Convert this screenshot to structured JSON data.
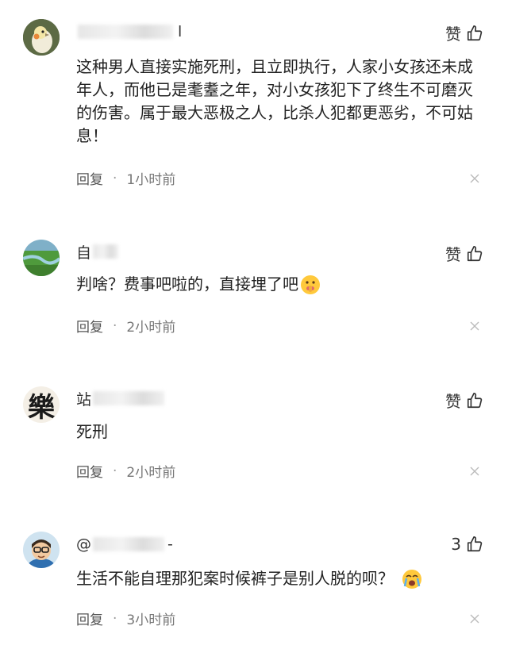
{
  "comments": [
    {
      "name_prefix": "",
      "name_suffix": "l",
      "like_label": "赞",
      "text": "这种男人直接实施死刑，且立即执行，人家小女孩还未成年人，而他已是耄耋之年，对小女孩犯下了终生不可磨灭的伤害。属于最大恶极之人，比杀人犯都更恶劣，不可姑息！",
      "reply_label": "回复",
      "dot": "·",
      "time": "1小时前"
    },
    {
      "name_prefix": "自",
      "name_suffix": "",
      "like_label": "赞",
      "text": "判啥？费事吧啦的，直接埋了吧",
      "reply_label": "回复",
      "dot": "·",
      "time": "2小时前"
    },
    {
      "name_prefix": "站",
      "name_suffix": "",
      "like_label": "赞",
      "text": "死刑",
      "reply_label": "回复",
      "dot": "·",
      "time": "2小时前"
    },
    {
      "name_prefix": "@",
      "name_suffix": "-",
      "like_label": "3",
      "text": "生活不能自理那犯案时候裤子是别人脱的呗？",
      "reply_label": "回复",
      "dot": "·",
      "time": "3小时前"
    }
  ],
  "avatar_3_char": "樂",
  "icons": {
    "like": "thumbs-up-icon",
    "close": "close-icon",
    "emoji_2": "shushing-face-emoji",
    "emoji_4": "crying-face-emoji"
  },
  "colors": {
    "text": "#222222",
    "meta": "#555555",
    "close": "#bbbbbb"
  }
}
